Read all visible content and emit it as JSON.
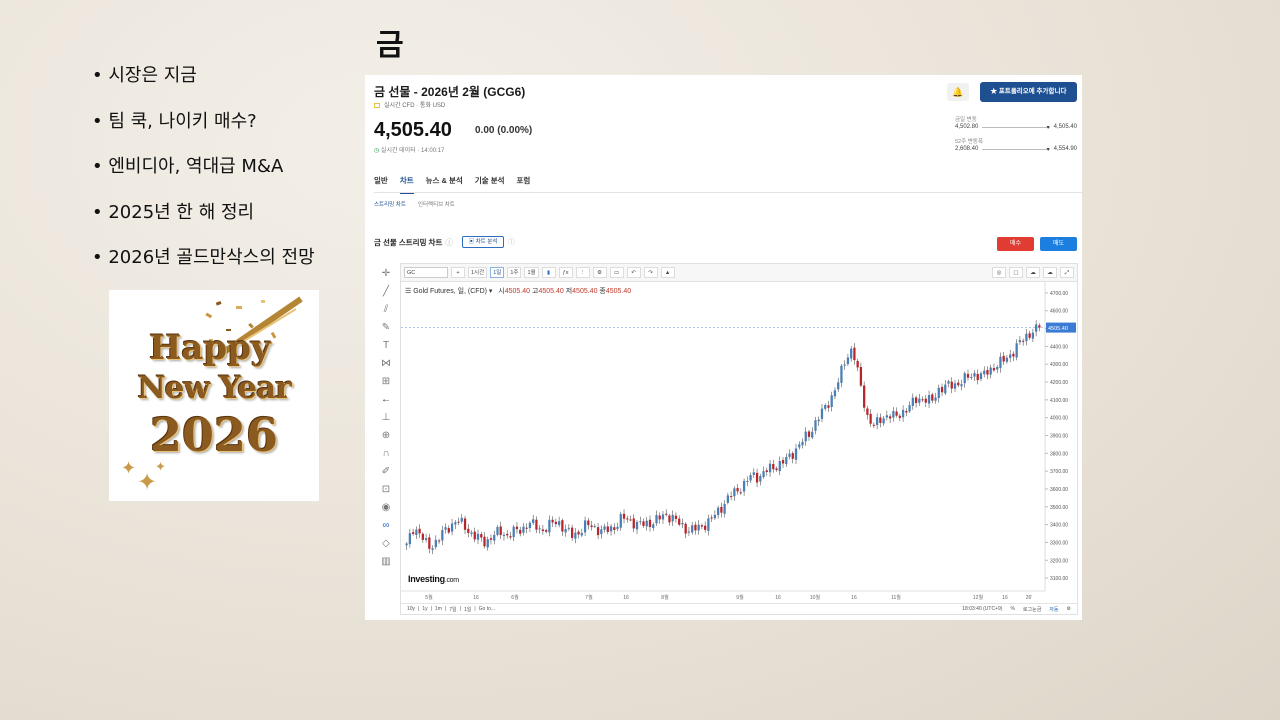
{
  "slide": {
    "title": "금",
    "bullets": [
      "시장은 지금",
      "팀 쿡, 나이키 매수?",
      "엔비디아, 역대급 M&A",
      "2025년 한 해 정리",
      "2026년 골드만삭스의 전망"
    ],
    "image": {
      "line1": "Happy",
      "line2": "New Year",
      "line3": "2026"
    }
  },
  "investing": {
    "title": "금 선물 - 2026년 2월 (GCG6)",
    "subtitle": "실시간 CFD · 통화 USD",
    "price": "4,505.40",
    "change": "0.00 (0.00%)",
    "realtime": "실시간 데이터 · 14:00:17",
    "portfolio_button": "포트폴리오에 추가합니다",
    "day_range": {
      "label": "금일 변동",
      "low": "4,502.80",
      "high": "4,505.40"
    },
    "week52_range": {
      "label": "52주 변동폭",
      "low": "2,608.40",
      "high": "4,554.90"
    },
    "tabs": [
      "일반",
      "차트",
      "뉴스 & 분석",
      "기술 분석",
      "포럼"
    ],
    "active_tab": "차트",
    "subtabs": [
      "스트리밍 차트",
      "인터랙티브 차트"
    ],
    "chart_title": "금 선물 스트리밍 차트",
    "analysis_button": "차트 분석",
    "buy_button": "매수",
    "sell_button": "매도",
    "toolbar": {
      "symbol": "GC",
      "intervals": [
        "1시간",
        "1일",
        "1주",
        "1월"
      ],
      "selected_interval": "1일"
    },
    "legend": {
      "name": "Gold Futures, 일, (CFD)",
      "o_label": "시",
      "o": "4505.40",
      "h_label": "고",
      "h": "4505.40",
      "l_label": "저",
      "l": "4505.40",
      "c_label": "종",
      "c": "4505.40"
    },
    "logo": {
      "main": "Investing",
      "suffix": ".com"
    },
    "bottom": {
      "ranges": [
        "10y",
        "1y",
        "1m",
        "7일",
        "1일",
        "Go to..."
      ],
      "time": "18:03:40 (UTC+9)",
      "pct": "%",
      "log": "로그눈금",
      "auto": "자동"
    }
  },
  "chart_data": {
    "type": "candlestick",
    "current_price_label": "4505.40",
    "ylim": [
      3050,
      4750
    ],
    "yticks": [
      3100,
      3200,
      3300,
      3400,
      3500,
      3600,
      3700,
      3800,
      3900,
      4000,
      4100,
      4200,
      4300,
      4400,
      4500,
      4600,
      4700
    ],
    "ytick_labels": [
      "3100.00",
      "3200.00",
      "3300.00",
      "3400.00",
      "3500.00",
      "3600.00",
      "3700.00",
      "3800.00",
      "3900.00",
      "4000.00",
      "4100.00",
      "4200.00",
      "4300.00",
      "4400.00",
      "4500.00",
      "4600.00",
      "4700.00"
    ],
    "xtick_labels": [
      "5월",
      "16",
      "6월",
      "7월",
      "16",
      "8월",
      "9월",
      "16",
      "10월",
      "16",
      "11월",
      "12월",
      "16",
      "26'"
    ],
    "close_path": [
      3280,
      3380,
      3330,
      3270,
      3310,
      3360,
      3390,
      3420,
      3380,
      3350,
      3330,
      3310,
      3340,
      3350,
      3330,
      3360,
      3380,
      3420,
      3390,
      3360,
      3390,
      3420,
      3380,
      3350,
      3360,
      3390,
      3380,
      3360,
      3380,
      3400,
      3440,
      3420,
      3390,
      3400,
      3420,
      3440,
      3460,
      3430,
      3390,
      3370,
      3380,
      3400,
      3420,
      3450,
      3500,
      3560,
      3600,
      3640,
      3680,
      3660,
      3690,
      3720,
      3750,
      3780,
      3820,
      3860,
      3900,
      3980,
      4050,
      4120,
      4200,
      4320,
      4380,
      4200,
      4020,
      3960,
      4000,
      4010,
      3990,
      4030,
      4070,
      4120,
      4110,
      4080,
      4150,
      4170,
      4190,
      4210,
      4230,
      4240,
      4220,
      4260,
      4300,
      4330,
      4360,
      4400,
      4440,
      4480,
      4505.4
    ]
  }
}
